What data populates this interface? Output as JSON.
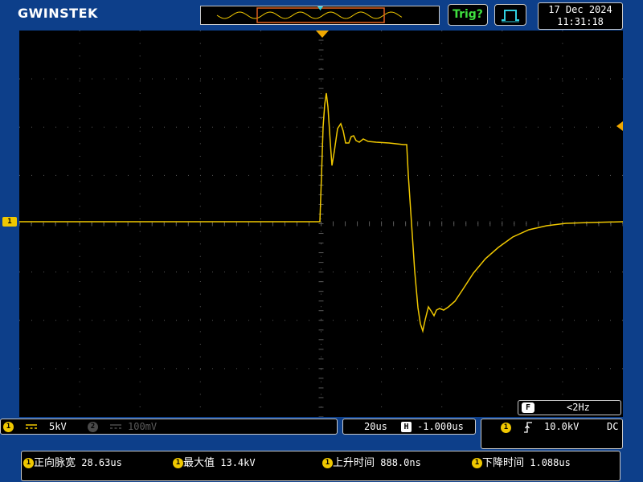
{
  "header": {
    "brand": "GWINSTEK",
    "trig_status": "Trig?",
    "date": "17 Dec 2024",
    "time": "11:31:18"
  },
  "frequency": {
    "badge": "F",
    "value": "<2Hz"
  },
  "channels": {
    "ch1": {
      "badge": "1",
      "coupling_icon": "dc-coupling-icon",
      "scale": "5kV",
      "color": "#f0c800"
    },
    "ch2": {
      "badge": "2",
      "coupling_icon": "dc-coupling-icon",
      "scale": "100mV",
      "color": "#4a4a4a"
    }
  },
  "timebase": {
    "scale": "20us",
    "position_badge": "H",
    "position": "-1.000us"
  },
  "trigger": {
    "source_badge": "1",
    "slope_icon": "rising-edge-icon",
    "level": "10.0kV",
    "coupling": "DC"
  },
  "measurements": [
    {
      "badge": "1",
      "label": "正向脉宽",
      "value": "28.63us"
    },
    {
      "badge": "1",
      "label": "最大值",
      "value": "13.4kV"
    },
    {
      "badge": "1",
      "label": "上升时间",
      "value": "888.0ns"
    },
    {
      "badge": "1",
      "label": "下降时间",
      "value": "1.088us"
    }
  ],
  "markers": {
    "ch1_level": "1"
  },
  "colors": {
    "background": "#0d3f8a",
    "trace": "#f0c800",
    "trigger_marker": "#f0a800",
    "grid": "#5a5a5a",
    "trig_status": "#3fe03f",
    "overview_window": "#e06020",
    "overview_pointer": "#30d0e0"
  }
}
